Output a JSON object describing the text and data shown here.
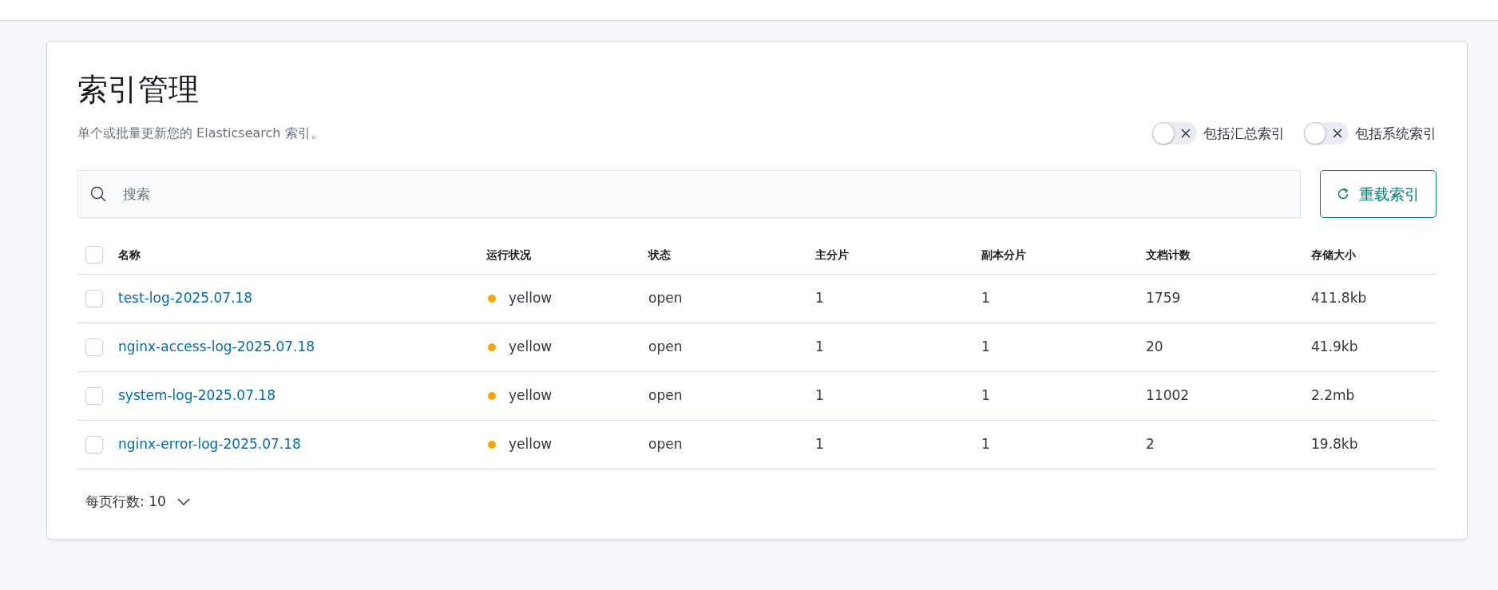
{
  "page": {
    "title": "索引管理",
    "description": "单个或批量更新您的 Elasticsearch 索引。"
  },
  "toggles": [
    {
      "label": "包括汇总索引",
      "on": false
    },
    {
      "label": "包括系统索引",
      "on": false
    }
  ],
  "search": {
    "placeholder": "搜索"
  },
  "reload_button": "重载索引",
  "table": {
    "select_all_checked": false,
    "columns": [
      "名称",
      "运行状况",
      "状态",
      "主分片",
      "副本分片",
      "文档计数",
      "存储大小"
    ],
    "rows": [
      {
        "checked": false,
        "name": "test-log-2025.07.18",
        "health": "yellow",
        "color": "#f5a700",
        "status": "open",
        "primary": "1",
        "replica": "1",
        "docs": "1759",
        "size": "411.8kb"
      },
      {
        "checked": false,
        "name": "nginx-access-log-2025.07.18",
        "health": "yellow",
        "color": "#f5a700",
        "status": "open",
        "primary": "1",
        "replica": "1",
        "docs": "20",
        "size": "41.9kb"
      },
      {
        "checked": false,
        "name": "system-log-2025.07.18",
        "health": "yellow",
        "color": "#f5a700",
        "status": "open",
        "primary": "1",
        "replica": "1",
        "docs": "11002",
        "size": "2.2mb"
      },
      {
        "checked": false,
        "name": "nginx-error-log-2025.07.18",
        "health": "yellow",
        "color": "#f5a700",
        "status": "open",
        "primary": "1",
        "replica": "1",
        "docs": "2",
        "size": "19.8kb"
      }
    ]
  },
  "pagination": {
    "rows_per_page": "每页行数: 10"
  }
}
